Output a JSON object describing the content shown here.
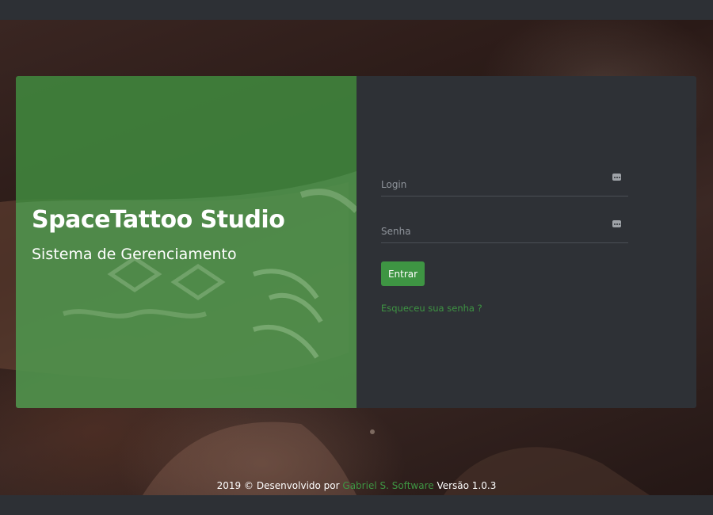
{
  "brand": {
    "title": "SpaceTattoo Studio",
    "subtitle": "Sistema de Gerenciamento"
  },
  "form": {
    "login_placeholder": "Login",
    "password_placeholder": "Senha",
    "submit_label": "Entrar",
    "forgot_label": "Esqueceu sua senha ?",
    "field_icon": "password-dots-icon"
  },
  "footer": {
    "prefix": "2019 © Desenvolvido por",
    "author": "Gabriel S. Software",
    "version": "Versão 1.0.3"
  },
  "colors": {
    "accent": "#3e9543",
    "panel_dark": "#2e3136",
    "panel_green": "#40893e",
    "chrome": "#2d3035"
  }
}
